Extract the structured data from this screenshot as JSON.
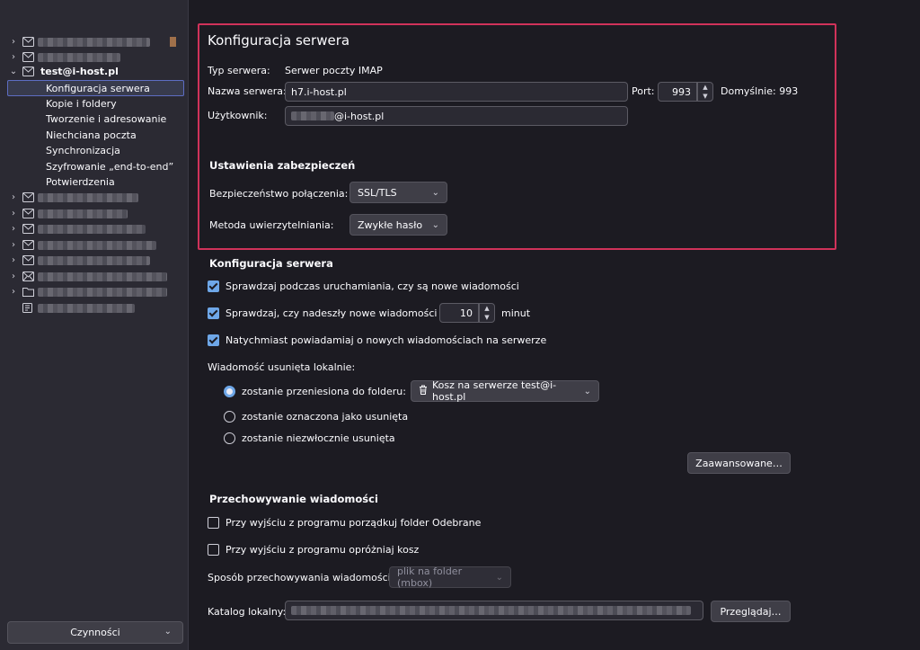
{
  "sidebar": {
    "account_name": "test@i-host.pl",
    "subitems": [
      "Konfiguracja serwera",
      "Kopie i foldery",
      "Tworzenie i adresowanie",
      "Niechciana poczta",
      "Synchronizacja",
      "Szyfrowanie „end-to-end”",
      "Potwierdzenia"
    ],
    "actions_label": "Czynności"
  },
  "server_box": {
    "title": "Konfiguracja serwera",
    "server_type_label": "Typ serwera:",
    "server_type_value": "Serwer poczty IMAP",
    "server_name_label": "Nazwa serwera:",
    "server_name_value": "h7.i-host.pl",
    "port_label": "Port:",
    "port_value": "993",
    "default_port": "Domyślnie: 993",
    "user_label": "Użytkownik:",
    "user_value_suffix": "@i-host.pl",
    "security_title": "Ustawienia zabezpieczeń",
    "connection_security_label": "Bezpieczeństwo połączenia:",
    "connection_security_value": "SSL/TLS",
    "auth_method_label": "Metoda uwierzytelniania:",
    "auth_method_value": "Zwykłe hasło"
  },
  "server_settings": {
    "title": "Konfiguracja serwera",
    "check_on_startup": "Sprawdzaj podczas uruchamiania, czy są nowe wiadomości",
    "check_every_prefix": "Sprawdzaj, czy nadeszły nowe wiadomości co",
    "check_every_value": "10",
    "check_every_suffix": "minut",
    "notify_immediately": "Natychmiast powiadamiaj o nowych wiadomościach na serwerze",
    "deleted_label": "Wiadomość usunięta lokalnie:",
    "radio_move": "zostanie przeniesiona do folderu:",
    "trash_folder": "Kosz na serwerze test@i-host.pl",
    "radio_mark": "zostanie oznaczona jako usunięta",
    "radio_delete": "zostanie niezwłocznie usunięta",
    "advanced_button": "Zaawansowane…"
  },
  "storage": {
    "title": "Przechowywanie wiadomości",
    "cleanup_inbox": "Przy wyjściu z programu porządkuj folder Odebrane",
    "empty_trash": "Przy wyjściu z programu opróżniaj kosz",
    "store_type_label": "Sposób przechowywania wiadomości:",
    "store_type_value": "plik na folder (mbox)",
    "local_dir_label": "Katalog lokalny:",
    "browse_button": "Przeglądaj…"
  },
  "colors": {
    "highlight": "#d0325a",
    "checkbox_accent": "#6ea7e8",
    "background": "#1c1b22",
    "sidebar": "#2b2a33"
  }
}
